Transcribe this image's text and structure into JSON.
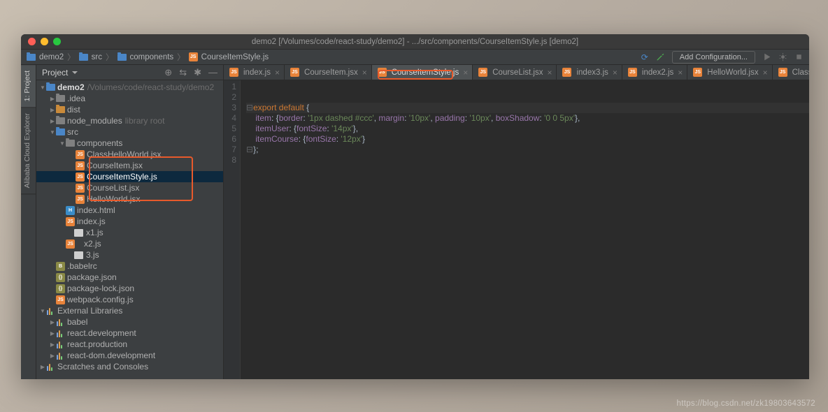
{
  "window": {
    "title": "demo2 [/Volumes/code/react-study/demo2] - .../src/components/CourseItemStyle.js [demo2]"
  },
  "breadcrumb": [
    "demo2",
    "src",
    "components",
    "CourseItemStyle.js"
  ],
  "nav": {
    "add_config": "Add Configuration..."
  },
  "left_tabs": {
    "project": "1: Project",
    "explorer": "Alibaba Cloud Explorer"
  },
  "project_panel": {
    "title": "Project",
    "root_label": "demo2",
    "root_path": "/Volumes/code/react-study/demo2",
    "nodes": {
      "idea": ".idea",
      "dist": "dist",
      "node_modules": "node_modules",
      "library_root": "library root",
      "src": "src",
      "components": "components",
      "class_hw": "ClassHelloWorld.jsx",
      "course_item": "CourseItem.jsx",
      "course_item_style": "CourseItemStyle.js",
      "course_list": "CourseList.jsx",
      "hello_world": "HelloWorld.jsx",
      "index_html": "index.html",
      "index_js": "index.js",
      "idx1": "x1.js",
      "idx2": "x2.js",
      "idx3": "3.js",
      "babelrc": ".babelrc",
      "pkg": "package.json",
      "pkglock": "package-lock.json",
      "webpack": "webpack.config.js",
      "ext_lib": "External Libraries",
      "babel": "babel",
      "react_dev": "react.development",
      "react_prod": "react.production",
      "react_dom_dev": "react-dom.development",
      "scratches": "Scratches and Consoles"
    }
  },
  "editor_tabs": [
    {
      "label": "index.js"
    },
    {
      "label": "CourseItem.jsx"
    },
    {
      "label": "CourseItemStyle.js",
      "active": true
    },
    {
      "label": "CourseList.jsx"
    },
    {
      "label": "index3.js"
    },
    {
      "label": "index2.js"
    },
    {
      "label": "HelloWorld.jsx"
    },
    {
      "label": "ClassHelloWorld.jsx"
    }
  ],
  "code": {
    "line_count": 8,
    "export": "export",
    "default": "default",
    "item": "item",
    "border": "border",
    "border_v": "'1px dashed #ccc'",
    "margin": "margin",
    "margin_v": "'10px'",
    "padding": "padding",
    "padding_v": "'10px'",
    "boxShadow": "boxShadow",
    "boxShadow_v": "'0 0 5px'",
    "itemUser": "itemUser",
    "fontSize": "fontSize",
    "fs14": "'14px'",
    "itemCourse": "itemCourse",
    "fs12": "'12px'"
  },
  "watermark": "https://blog.csdn.net/zk19803643572"
}
